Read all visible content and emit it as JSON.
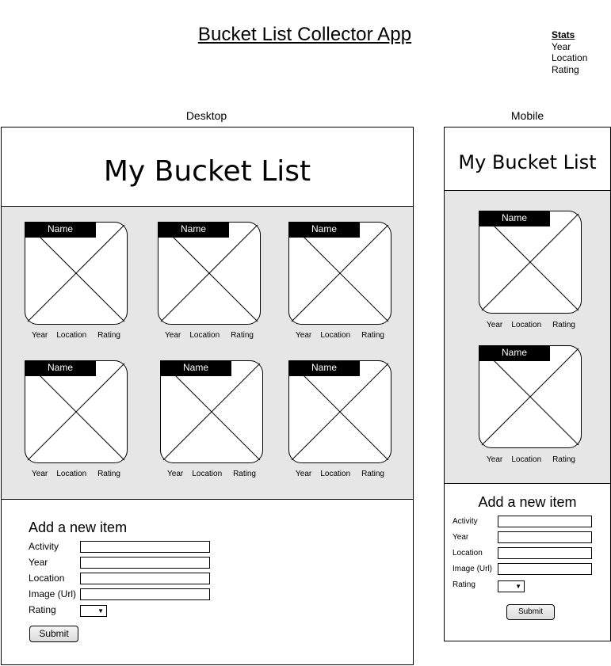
{
  "app_title": "Bucket List Collector App",
  "stats": {
    "header": "Stats",
    "items": [
      "Year",
      "Location",
      "Rating"
    ]
  },
  "frames": {
    "desktop_label": "Desktop",
    "mobile_label": "Mobile"
  },
  "list_heading": "My Bucket List",
  "card": {
    "name_label": "Name",
    "year": "Year",
    "location": "Location",
    "rating": "Rating"
  },
  "form": {
    "title": "Add a new item",
    "activity_label": "Activity",
    "year_label": "Year",
    "location_label": "Location",
    "image_label": "Image (Url)",
    "rating_label": "Rating",
    "rating_arrow": "▼",
    "submit_label": "Submit"
  }
}
